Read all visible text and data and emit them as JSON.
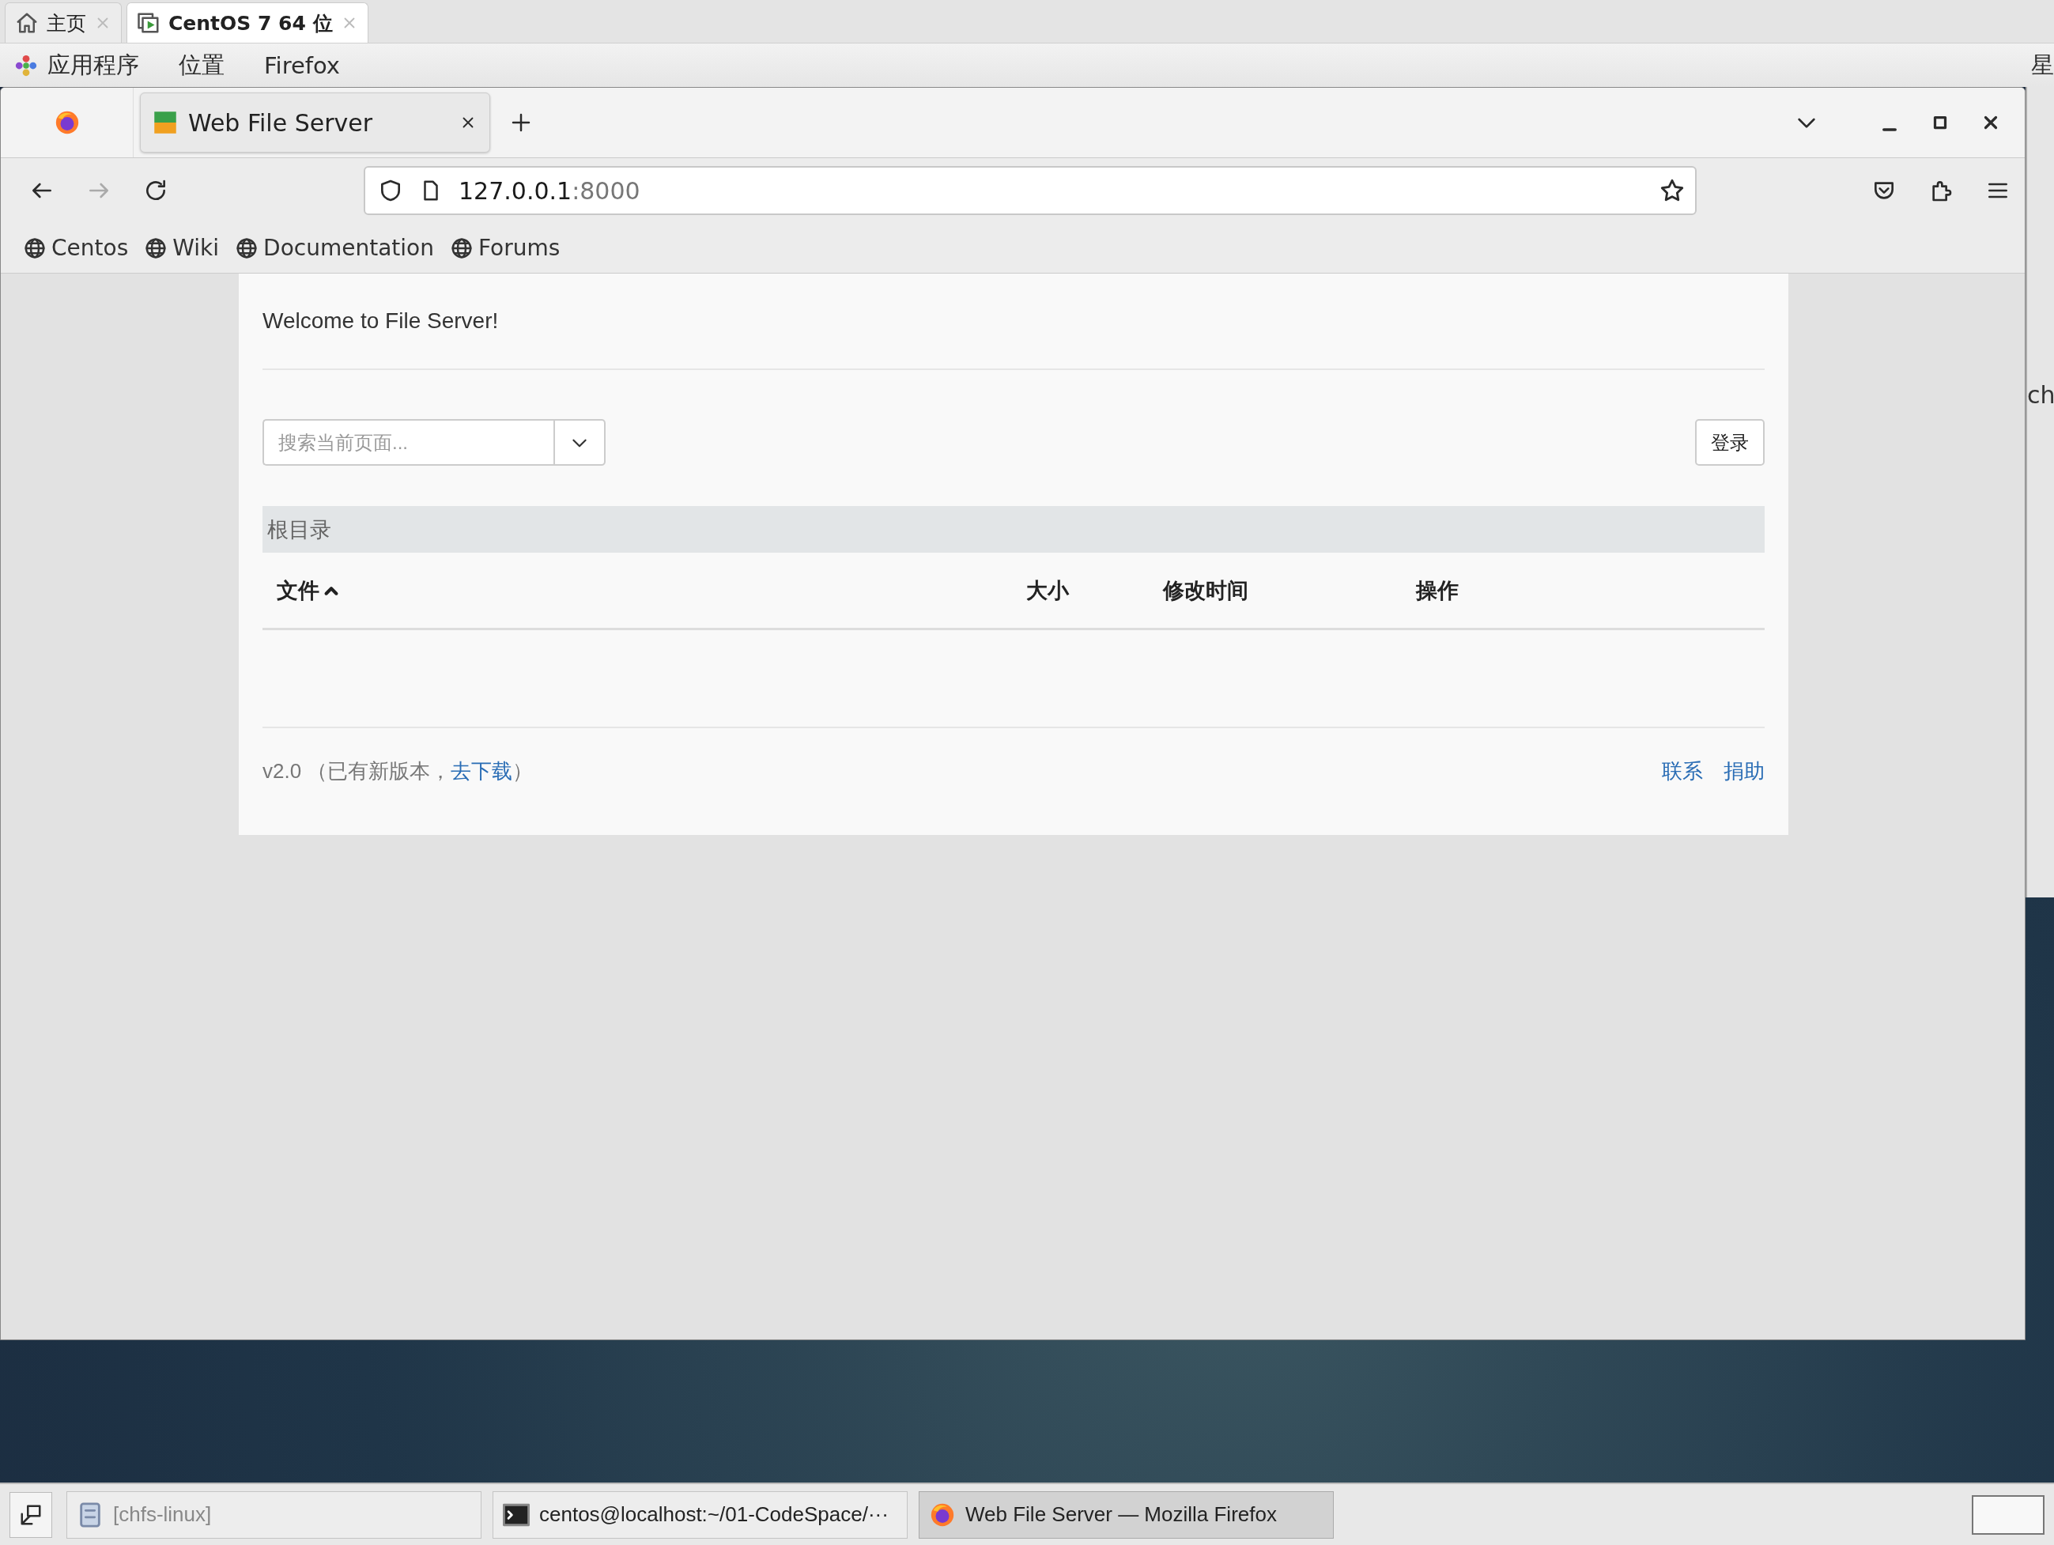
{
  "vm_tabs": [
    {
      "label": "主页",
      "kind": "home",
      "selected": false
    },
    {
      "label": "CentOS 7 64 位",
      "kind": "vm",
      "selected": true
    }
  ],
  "top_bar": {
    "menus": [
      "应用程序",
      "位置",
      "Firefox"
    ],
    "clock": "星"
  },
  "browser": {
    "tabs": [
      {
        "title": "Web File Server",
        "selected": true
      }
    ],
    "url": {
      "host": "127.0.0.1",
      "port": ":8000"
    },
    "bookmarks": [
      "Centos",
      "Wiki",
      "Documentation",
      "Forums"
    ]
  },
  "page": {
    "welcome": "Welcome to File Server!",
    "search": {
      "placeholder": "搜索当前页面..."
    },
    "login_button": "登录",
    "breadcrumb": "根目录",
    "columns": [
      {
        "label": "文件",
        "sorted": true
      },
      {
        "label": "大小",
        "sorted": false
      },
      {
        "label": "修改时间",
        "sorted": false
      },
      {
        "label": "操作",
        "sorted": false
      }
    ],
    "footer": {
      "version": "v2.0",
      "note_open": "（已有新版本，",
      "download_link": "去下载",
      "note_close": "）",
      "links": [
        "联系",
        "捐助"
      ]
    }
  },
  "background_window": {
    "text": "ch"
  },
  "taskbar": {
    "items": [
      {
        "label": "[chfs-linux]",
        "kind": "files",
        "selected": false
      },
      {
        "label": "centos@localhost:~/01-CodeSpace/···",
        "kind": "terminal",
        "selected": false
      },
      {
        "label": "Web File Server — Mozilla Firefox",
        "kind": "firefox",
        "selected": true
      }
    ]
  }
}
